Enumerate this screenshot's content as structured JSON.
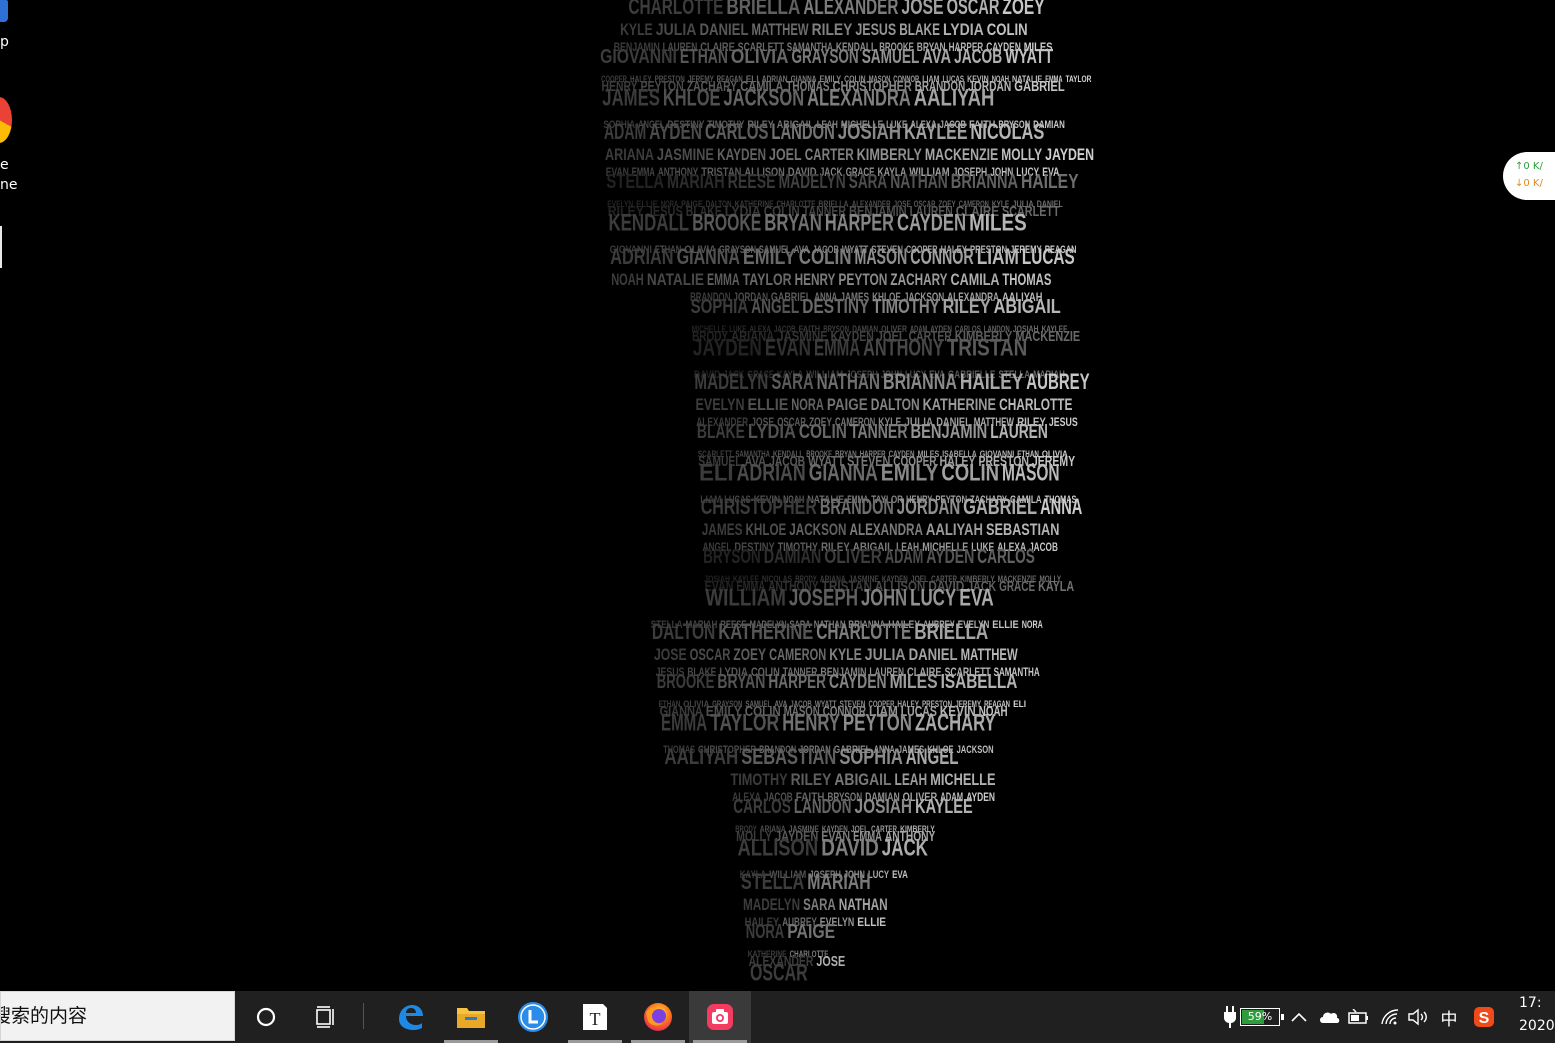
{
  "desktop": {
    "icons": [
      {
        "label_lines": [
          "p"
        ]
      },
      {
        "label_lines": [
          "e",
          "ne"
        ]
      }
    ]
  },
  "network_widget": {
    "upload": "↑0  K/",
    "download": "↓0  K/"
  },
  "taskbar": {
    "search_text": "搜索的内容",
    "apps": [
      {
        "name": "edge-icon",
        "active": false
      },
      {
        "name": "file-explorer-icon",
        "active": false
      },
      {
        "name": "l-app-icon",
        "active": false
      },
      {
        "name": "typora-icon",
        "active": false
      },
      {
        "name": "firefox-icon",
        "active": false
      },
      {
        "name": "screenshot-app-icon",
        "active": true
      }
    ],
    "tray": {
      "battery_percent": "59%",
      "input_method": "中",
      "clock_time": "17:",
      "clock_date": "2020"
    }
  },
  "wallpaper": {
    "names": [
      "CHARLOTTE",
      "BRIELLA",
      "ALEXANDER",
      "JOSE",
      "OSCAR",
      "ZOEY",
      "CAMERON",
      "KYLE",
      "JULIA",
      "DANIEL",
      "MATTHEW",
      "RILEY",
      "JESUS",
      "BLAKE",
      "LYDIA",
      "COLIN",
      "TANNER",
      "BENJAMIN",
      "LAUREN",
      "CLAIRE",
      "SCARLETT",
      "SAMANTHA",
      "KENDALL",
      "BROOKE",
      "BRYAN",
      "HARPER",
      "CAYDEN",
      "MILES",
      "ISABELLA",
      "GIOVANNI",
      "ETHAN",
      "OLIVIA",
      "GRAYSON",
      "SAMUEL",
      "AVA",
      "JACOB",
      "WYATT",
      "STEVEN",
      "COOPER",
      "HALEY",
      "PRESTON",
      "JEREMY",
      "REAGAN",
      "ELI",
      "ADRIAN",
      "GIANNA",
      "EMILY",
      "COLIN",
      "MASON",
      "CONNOR",
      "LIAM",
      "LUCAS",
      "KEVIN",
      "NOAH",
      "NATALIE",
      "EMMA",
      "TAYLOR",
      "HENRY",
      "PEYTON",
      "ZACHARY",
      "CAMILA",
      "THOMAS",
      "CHRISTOPHER",
      "BRANDON",
      "JORDAN",
      "GABRIEL",
      "ANNA",
      "JAMES",
      "KHLOE",
      "JACKSON",
      "ALEXANDRA",
      "AALIYAH",
      "SEBASTIAN",
      "SOPHIA",
      "ANGEL",
      "DESTINY",
      "TIMOTHY",
      "RILEY",
      "ABIGAIL",
      "LEAH",
      "MICHELLE",
      "LUKE",
      "ALEXA",
      "JACOB",
      "FAITH",
      "BRYSON",
      "DAMIAN",
      "OLIVER",
      "ADAM",
      "AYDEN",
      "CARLOS",
      "LANDON",
      "JOSIAH",
      "KAYLEE",
      "NICOLAS",
      "BRODY",
      "ARIANA",
      "JASMINE",
      "KAYDEN",
      "JOEL",
      "CARTER",
      "KIMBERLY",
      "MACKENZIE",
      "MOLLY",
      "JAYDEN",
      "EVAN",
      "EMMA",
      "ANTHONY",
      "TRISTAN",
      "ALLISON",
      "DAVID",
      "JACK",
      "GRACE",
      "KAYLA",
      "WILLIAM",
      "JOSEPH",
      "JOHN",
      "LUCY",
      "EVA",
      "GABRIELLE",
      "STELLA",
      "MARIAH",
      "REESE",
      "MADELYN",
      "SARA",
      "NATHAN",
      "BRIANNA",
      "HAILEY",
      "AUBREY",
      "EVELYN",
      "ELLIE",
      "NORA",
      "PAIGE",
      "DALTON",
      "KATHERINE"
    ]
  }
}
